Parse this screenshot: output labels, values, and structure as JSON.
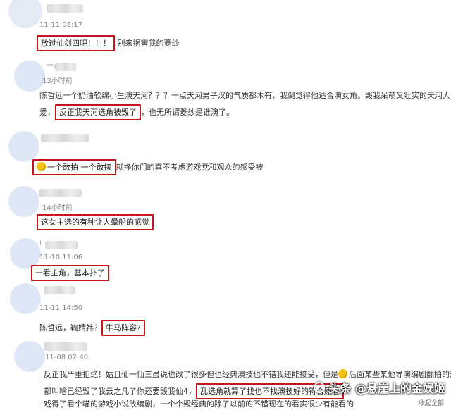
{
  "comments": [
    {
      "time": "11-11 08:17",
      "highlight": "放过仙剑四吧！！！",
      "rest": "别来祸害我的菱纱"
    },
    {
      "time": "13小时前",
      "name_fragment": "一、",
      "line1": "陈哲远一个奶油软绵小生演天河？？？一点天河男子汉的气质都木有，我倒觉得他适合演女角。毁我呆萌又壮实的天河大可",
      "line2_pre": "爱，",
      "highlight": "反正我天河选角被毁了",
      "line2_post": "，也无所谓菱纱是谁演了。"
    },
    {
      "time": "",
      "highlight": "一个敢拍 一个敢接",
      "rest": "就挣你们的真不考虑游戏党和观众的感受被"
    },
    {
      "time": "14小时前",
      "highlight": "这女主选的有种让人晕船的感觉"
    },
    {
      "time": "11-10 11:06",
      "name_fragment": "i",
      "highlight": "一看主角，基本扑了"
    },
    {
      "time": "11-11 14:50",
      "pre": "陈哲远，鞠婧祎？",
      "highlight": "牛马阵容?"
    },
    {
      "time": "11-08 02:40",
      "line1": "反正我严重拒绝！姑且仙一仙三虽说也改了很多但也经典演技也不错我还能接受，但是",
      "line1_post": "后面某些某他导演编剧翻拍的这",
      "line2_pre": "都叫啥已经毁了我云之凡了你还要毁我仙4，",
      "highlight": "乱选角就算了找也不找演技好的符合原著",
      "line3": "戏得了看个喵的游戏小说改编剧，一个个毁经典的除了以前的不错现在的看实很少有能看的"
    }
  ],
  "watermark": "头条 @悬崖上的金娱姬",
  "expand_label": "收起全部"
}
